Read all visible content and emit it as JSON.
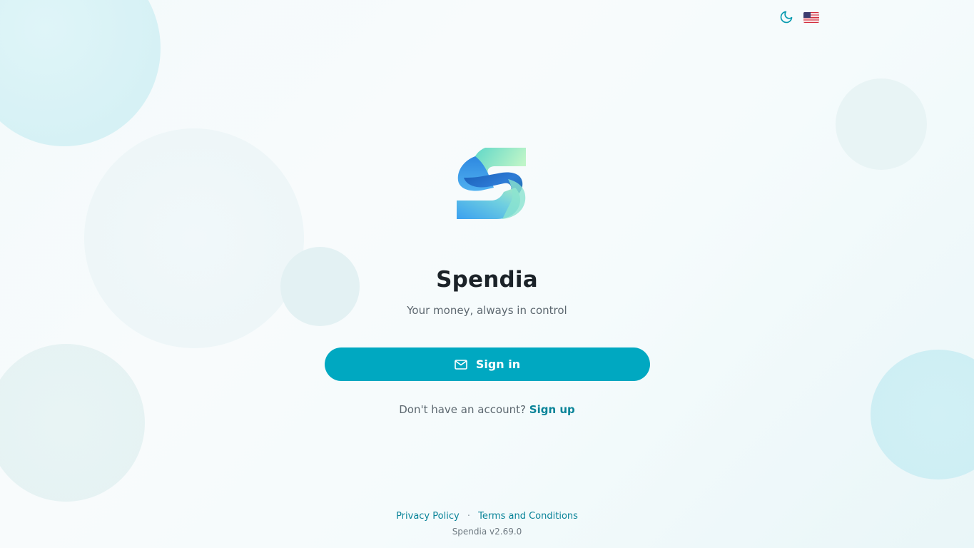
{
  "app": {
    "name": "Spendia",
    "tagline": "Your money, always in control",
    "accent_color": "#00a8c1",
    "link_color": "#0a8499"
  },
  "header": {
    "theme_toggle_icon": "moon-icon",
    "language_flag": "us-flag-icon"
  },
  "auth": {
    "signin_label": "Sign in",
    "signin_icon": "mail-icon",
    "no_account_text": "Don't have an account?",
    "signup_label": "Sign up"
  },
  "footer": {
    "privacy_label": "Privacy Policy",
    "separator": "·",
    "terms_label": "Terms and Conditions",
    "version": "Spendia v2.69.0"
  }
}
